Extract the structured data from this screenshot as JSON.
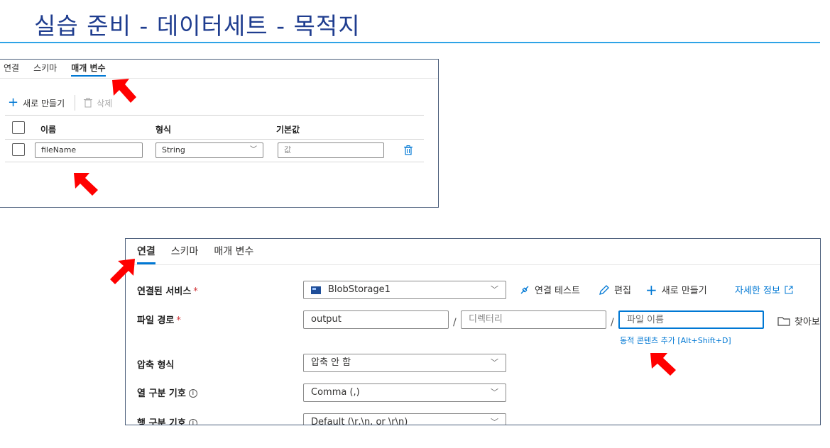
{
  "slide": {
    "title": "실습 준비 - 데이터세트 - 목적지",
    "accent": "#2ea3e6",
    "title_color": "#1f3d8f"
  },
  "params_panel": {
    "tabs": [
      {
        "label": "연결",
        "active": false
      },
      {
        "label": "스키마",
        "active": false
      },
      {
        "label": "매개 변수",
        "active": true
      }
    ],
    "toolbar": {
      "new_label": "새로 만들기",
      "delete_label": "삭제"
    },
    "columns": {
      "name": "이름",
      "type": "형식",
      "default": "기본값"
    },
    "row": {
      "name_value": "fileName",
      "type_value": "String",
      "default_placeholder": "값"
    }
  },
  "connection_panel": {
    "tabs": [
      {
        "label": "연결",
        "active": true
      },
      {
        "label": "스키마",
        "active": false
      },
      {
        "label": "매개 변수",
        "active": false
      }
    ],
    "linked_service": {
      "label": "연결된 서비스",
      "required_mark": "*",
      "value": "BlobStorage1",
      "actions": {
        "test": "연결 테스트",
        "edit": "편집",
        "new": "새로 만들기",
        "more": "자세한 정보"
      }
    },
    "file_path": {
      "label": "파일 경로",
      "required_mark": "*",
      "container": "output",
      "directory_placeholder": "디렉터리",
      "file_placeholder": "파일 이름",
      "browse": "찾아보",
      "separator": "/",
      "dynamic_content": "동적 콘텐츠 추가 [Alt+Shift+D]"
    },
    "compression": {
      "label": "압축 형식",
      "value": "압축 안 함"
    },
    "column_delimiter": {
      "label": "열 구분 기호",
      "value": "Comma (,)"
    },
    "row_delimiter": {
      "label": "행 구분 기호",
      "value": "Default (\\r,\\n, or \\r\\n)"
    }
  },
  "colors": {
    "primary": "#0078d4",
    "arrow": "#ff0000",
    "required": "#d13438"
  }
}
